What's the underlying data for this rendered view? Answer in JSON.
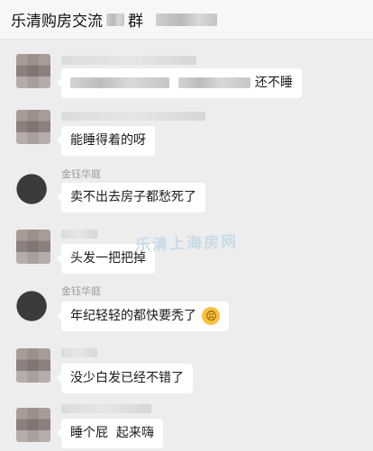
{
  "header": {
    "title": "乐清购房交流",
    "title_suffix": "群"
  },
  "messages": [
    {
      "sender": "",
      "text": "还不睡",
      "has_blurred_prefix": true
    },
    {
      "sender": "",
      "text": "能睡得着的呀"
    },
    {
      "sender": "金钰华庭",
      "text": "卖不出去房子都愁死了"
    },
    {
      "sender": "",
      "text": "头发一把把掉"
    },
    {
      "sender": "金钰华庭",
      "text": "年纪轻轻的都快要秃了",
      "emoji": "angry-face-icon"
    },
    {
      "sender": "",
      "text": "没少白发已经不错了"
    },
    {
      "sender": "",
      "text": "睡个屁  起来嗨"
    }
  ],
  "watermark": "乐清上海房网",
  "colors": {
    "background": "#ededed",
    "bubble": "#ffffff",
    "emoji": "#f6c23e"
  }
}
